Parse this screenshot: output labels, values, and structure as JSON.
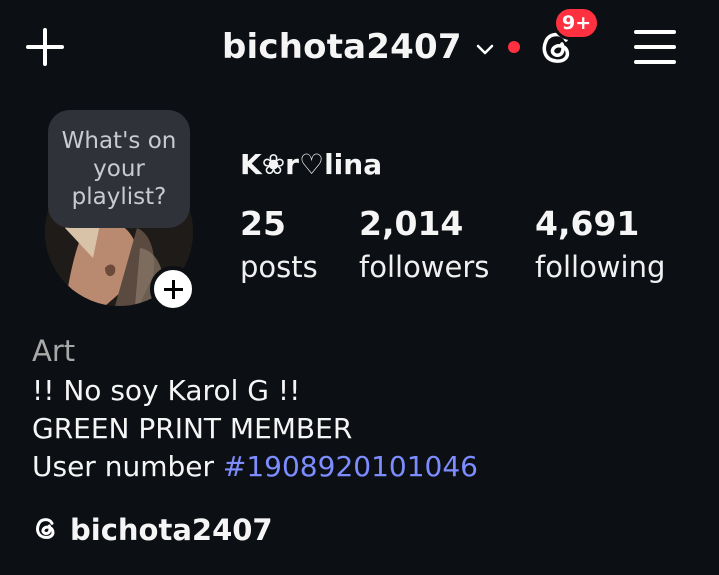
{
  "header": {
    "username": "bichota2407",
    "notification_badge": "9+",
    "accent_red": "#ff3040"
  },
  "note": {
    "text": "What's on your playlist?"
  },
  "profile": {
    "display_name": "K❀r♡lina",
    "stats": [
      {
        "value": "25",
        "label": "posts"
      },
      {
        "value": "2,014",
        "label": "followers"
      },
      {
        "value": "4,691",
        "label": "following"
      }
    ]
  },
  "bio": {
    "category": "Art",
    "line1": "!! No soy Karol G !!",
    "line2": "GREEN PRINT MEMBER",
    "line3_prefix": "User number ",
    "hashtag": "#1908920101046",
    "hashtag_color": "#7d8cff"
  },
  "threads_link": {
    "label": "bichota2407"
  },
  "icons": [
    "plus-icon",
    "chevron-down-icon",
    "threads-icon",
    "menu-icon",
    "add-story-icon"
  ]
}
